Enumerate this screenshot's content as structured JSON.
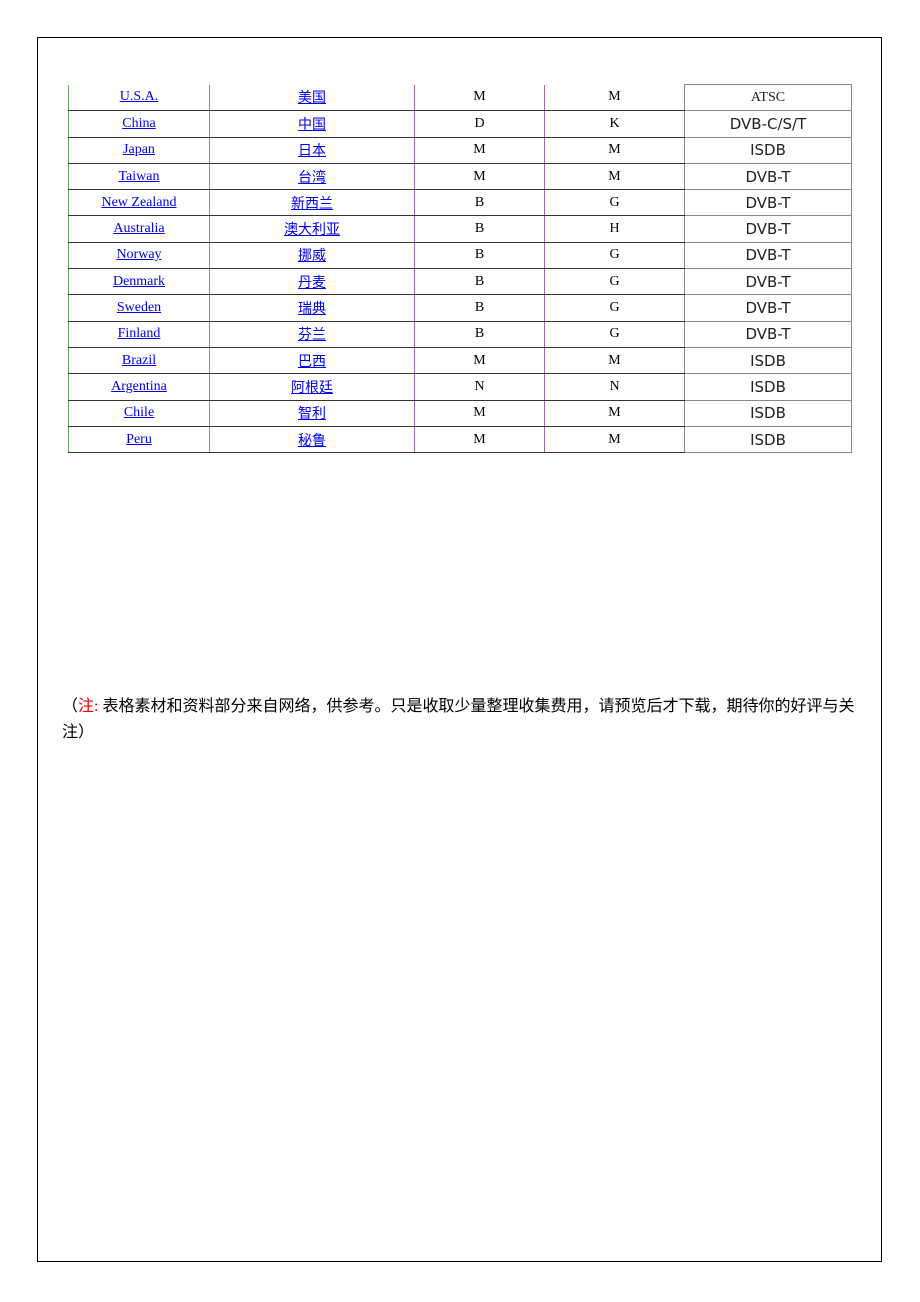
{
  "table": {
    "rows": [
      [
        "U.S.A.",
        "美国",
        "M",
        "M",
        "ATSC"
      ],
      [
        "China",
        "中国",
        "D",
        "K",
        "DVB-C/S/T"
      ],
      [
        "Japan",
        "日本",
        "M",
        "M",
        "ISDB"
      ],
      [
        "Taiwan",
        "台湾",
        "M",
        "M",
        "DVB-T"
      ],
      [
        "New Zealand",
        "新西兰",
        "B",
        "G",
        "DVB-T"
      ],
      [
        "Australia",
        "澳大利亚",
        "B",
        "H",
        "DVB-T"
      ],
      [
        "Norway",
        "挪威",
        "B",
        "G",
        "DVB-T"
      ],
      [
        "Denmark",
        "丹麦",
        "B",
        "G",
        "DVB-T"
      ],
      [
        "Sweden",
        "瑞典",
        "B",
        "G",
        "DVB-T"
      ],
      [
        "Finland",
        "芬兰",
        "B",
        "G",
        "DVB-T"
      ],
      [
        "Brazil",
        "巴西",
        "M",
        "M",
        "ISDB"
      ],
      [
        "Argentina",
        "阿根廷",
        "N",
        "N",
        "ISDB"
      ],
      [
        "Chile",
        "智利",
        "M",
        "M",
        "ISDB"
      ],
      [
        "Peru",
        "秘鲁",
        "M",
        "M",
        "ISDB"
      ]
    ]
  },
  "note": {
    "open": "（",
    "label": "注:",
    "text": " 表格素材和资料部分来自网络，供参考。只是收取少量整理收集费用，请预览后才下载，期待你的好评与关注）"
  },
  "colors": {
    "link": "#0000ee",
    "note_label": "#ee0000"
  }
}
